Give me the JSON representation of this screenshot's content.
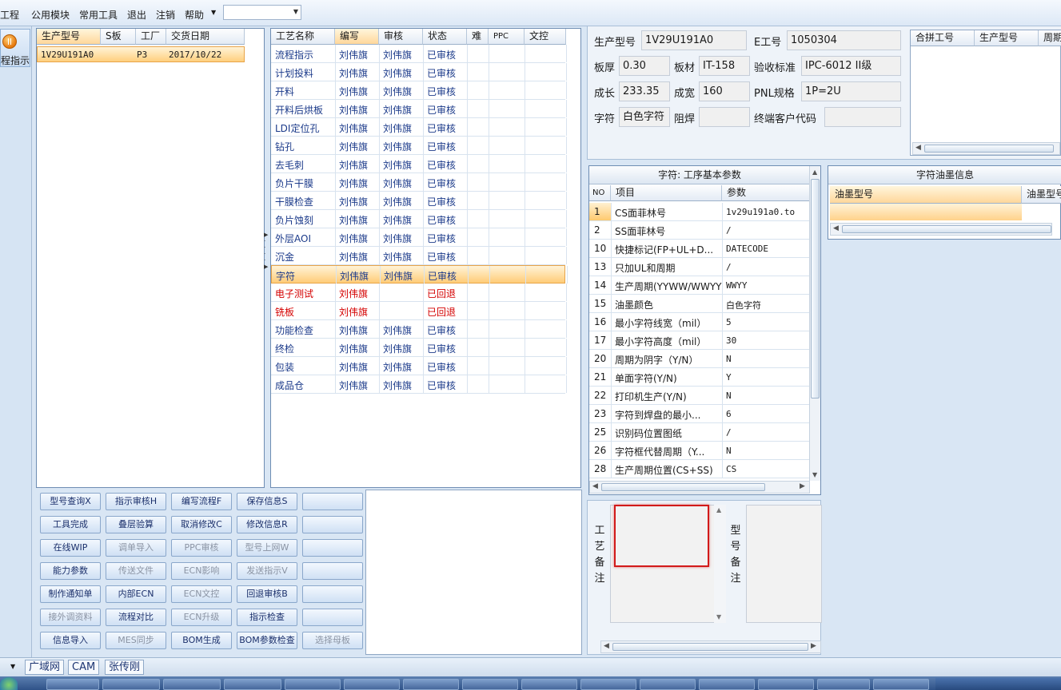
{
  "menu": [
    "工程",
    "公用模块",
    "常用工具",
    "退出",
    "注销",
    "帮助"
  ],
  "menu_combo_value": "",
  "sidebar_button_label": "程指示",
  "model_table": {
    "headers": [
      "生产型号",
      "S板",
      "工厂",
      "交货日期"
    ],
    "rows": [
      [
        "1V29U191A0",
        "",
        "P3",
        "2017/10/22"
      ]
    ]
  },
  "process_table": {
    "headers": [
      "工艺名称",
      "编写",
      "审核",
      "状态",
      "难",
      "PPC",
      "文控"
    ],
    "rows": [
      {
        "name": "流程指示",
        "writer": "刘伟旗",
        "reviewer": "刘伟旗",
        "status": "已审核"
      },
      {
        "name": "计划投料",
        "writer": "刘伟旗",
        "reviewer": "刘伟旗",
        "status": "已审核"
      },
      {
        "name": "开料",
        "writer": "刘伟旗",
        "reviewer": "刘伟旗",
        "status": "已审核"
      },
      {
        "name": "开料后烘板",
        "writer": "刘伟旗",
        "reviewer": "刘伟旗",
        "status": "已审核"
      },
      {
        "name": "LDI定位孔",
        "writer": "刘伟旗",
        "reviewer": "刘伟旗",
        "status": "已审核"
      },
      {
        "name": "钻孔",
        "writer": "刘伟旗",
        "reviewer": "刘伟旗",
        "status": "已审核"
      },
      {
        "name": "去毛刺",
        "writer": "刘伟旗",
        "reviewer": "刘伟旗",
        "status": "已审核"
      },
      {
        "name": "负片干膜",
        "writer": "刘伟旗",
        "reviewer": "刘伟旗",
        "status": "已审核"
      },
      {
        "name": "干膜检查",
        "writer": "刘伟旗",
        "reviewer": "刘伟旗",
        "status": "已审核"
      },
      {
        "name": "负片蚀刻",
        "writer": "刘伟旗",
        "reviewer": "刘伟旗",
        "status": "已审核"
      },
      {
        "name": "外层AOI",
        "writer": "刘伟旗",
        "reviewer": "刘伟旗",
        "status": "已审核"
      },
      {
        "name": "沉金",
        "writer": "刘伟旗",
        "reviewer": "刘伟旗",
        "status": "已审核"
      },
      {
        "name": "字符",
        "writer": "刘伟旗",
        "reviewer": "刘伟旗",
        "status": "已审核"
      },
      {
        "name": "电子测试",
        "writer": "刘伟旗",
        "reviewer": "",
        "status": "已回退"
      },
      {
        "name": "铣板",
        "writer": "刘伟旗",
        "reviewer": "",
        "status": "已回退"
      },
      {
        "name": "功能检查",
        "writer": "刘伟旗",
        "reviewer": "刘伟旗",
        "status": "已审核"
      },
      {
        "name": "终检",
        "writer": "刘伟旗",
        "reviewer": "刘伟旗",
        "status": "已审核"
      },
      {
        "name": "包装",
        "writer": "刘伟旗",
        "reviewer": "刘伟旗",
        "status": "已审核"
      },
      {
        "name": "成品仓",
        "writer": "刘伟旗",
        "reviewer": "刘伟旗",
        "status": "已审核"
      }
    ]
  },
  "buttons": [
    [
      "型号查询X",
      "指示审核H",
      "编写流程F",
      "保存信息S",
      ""
    ],
    [
      "工具完成",
      "叠层验算",
      "取消修改C",
      "修改信息R",
      ""
    ],
    [
      "在线WIP",
      "调单导入",
      "PPC审核",
      "型号上网W",
      ""
    ],
    [
      "能力参数",
      "传送文件",
      "ECN影响",
      "发送指示V",
      ""
    ],
    [
      "制作通知单",
      "内部ECN",
      "ECN文控",
      "回退审核B",
      ""
    ],
    [
      "接外调资料",
      "流程对比",
      "ECN升级",
      "指示检查",
      ""
    ],
    [
      "信息导入",
      "MES同步",
      "BOM生成",
      "BOM参数检查",
      "选择母板"
    ]
  ],
  "info": {
    "model_label": "生产型号",
    "model_value": "1V29U191A0",
    "eno_label": "E工号",
    "eno_value": "1050304",
    "thickness_label": "板厚",
    "thickness_value": "0.30",
    "material_label": "板材",
    "material_value": "IT-158",
    "standard_label": "验收标准",
    "standard_value": "IPC-6012 II级",
    "length_label": "成长",
    "length_value": "233.35",
    "width_label": "成宽",
    "width_value": "160",
    "pnl_label": "PNL规格",
    "pnl_value": "1P=2U",
    "char_label": "字符",
    "char_value": "白色字符",
    "mask_label": "阻焊",
    "mask_value": "",
    "client_label": "终端客户代码",
    "client_value": ""
  },
  "merge_table": {
    "headers": [
      "合拼工号",
      "生产型号",
      "周期"
    ]
  },
  "params": {
    "title": "字符: 工序基本参数",
    "headers": [
      "NO",
      "项目",
      "参数"
    ],
    "rows": [
      {
        "no": "1",
        "item": "CS面菲林号",
        "value": "1v29u191a0.to"
      },
      {
        "no": "2",
        "item": "SS面菲林号",
        "value": "/"
      },
      {
        "no": "10",
        "item": "快捷标记(FP+UL+D...",
        "value": "DATECODE"
      },
      {
        "no": "13",
        "item": "只加UL和周期",
        "value": "/"
      },
      {
        "no": "14",
        "item": "生产周期(YYWW/WWYY)",
        "value": "WWYY"
      },
      {
        "no": "15",
        "item": "油墨颜色",
        "value": "白色字符"
      },
      {
        "no": "16",
        "item": "最小字符线宽（mil）",
        "value": "5"
      },
      {
        "no": "17",
        "item": "最小字符高度（mil）",
        "value": "30"
      },
      {
        "no": "20",
        "item": "周期为阴字（Y/N）",
        "value": "N"
      },
      {
        "no": "21",
        "item": "单面字符(Y/N)",
        "value": "Y"
      },
      {
        "no": "22",
        "item": "打印机生产(Y/N)",
        "value": "N"
      },
      {
        "no": "23",
        "item": "字符到焊盘的最小...",
        "value": "6"
      },
      {
        "no": "25",
        "item": "识别码位置图纸",
        "value": "/"
      },
      {
        "no": "26",
        "item": "字符框代替周期（Y...",
        "value": "N"
      },
      {
        "no": "28",
        "item": "生产周期位置(CS+SS)",
        "value": "CS"
      }
    ]
  },
  "ink": {
    "title": "字符油墨信息",
    "headers": [
      "油墨型号",
      "油墨型号"
    ]
  },
  "remarks": {
    "process_label": "工艺备注",
    "model_label": "型号备注"
  },
  "status_tabs": [
    "广域网",
    "CAM",
    "张传刚"
  ]
}
